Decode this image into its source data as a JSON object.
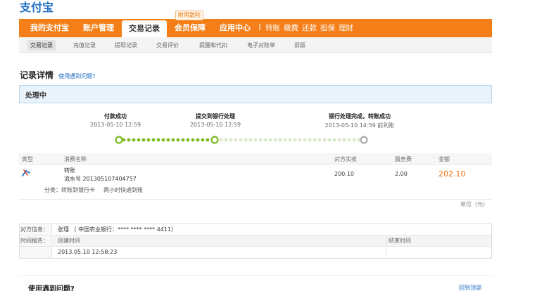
{
  "logo": {
    "text": "支付宝"
  },
  "nav": {
    "items": [
      "我的支付宝",
      "账户管理",
      "交易记录",
      "会员保障",
      "应用中心"
    ],
    "promo": "附用散险",
    "sub_items": [
      "转账",
      "缴费",
      "还款",
      "担保",
      "理财"
    ]
  },
  "subnav": {
    "items": [
      "交易记录",
      "充值记录",
      "提现记录",
      "交易评价",
      "提醒和代扣",
      "电子对账单",
      "旧版"
    ]
  },
  "page": {
    "title": "记录详情",
    "help_link": "使用遇到问题？",
    "status": "处理中"
  },
  "steps": [
    {
      "title": "付款成功",
      "time": "2013-05-10 12:59"
    },
    {
      "title": "提交到银行处理",
      "time": "2013-05-10 12:59"
    },
    {
      "title": "银行处理完成，转账成功",
      "time": "2013-05-10 14:59 前到账"
    }
  ],
  "table": {
    "headers": [
      "类型",
      "消费名称",
      "对方实收",
      "服务费",
      "金额"
    ],
    "row": {
      "name": "转账",
      "serial": "流水号 201305107404757",
      "received": "200.10",
      "fee": "2.00",
      "amount": "202.10"
    },
    "category_label": "分类：转账到银行卡",
    "category_note": "两小时快速到账",
    "unit": "单位（元）"
  },
  "info": {
    "party_label": "对方信息：",
    "party_value": "张瑾 （ 中国农业银行：**** **** **** 4411）",
    "time_label": "时间报告：",
    "created_header": "创建时间",
    "finished_header": "结束时间",
    "created_value": "2013.05.10 12:58:23"
  },
  "footer": {
    "title": "使用遇到问题?",
    "back_to_top": "回到顶部"
  },
  "colors": {
    "nav_orange": "#f47f18",
    "link_blue": "#1869c2",
    "amount_orange": "#f06d0c",
    "progress_green": "#7dbb20"
  }
}
